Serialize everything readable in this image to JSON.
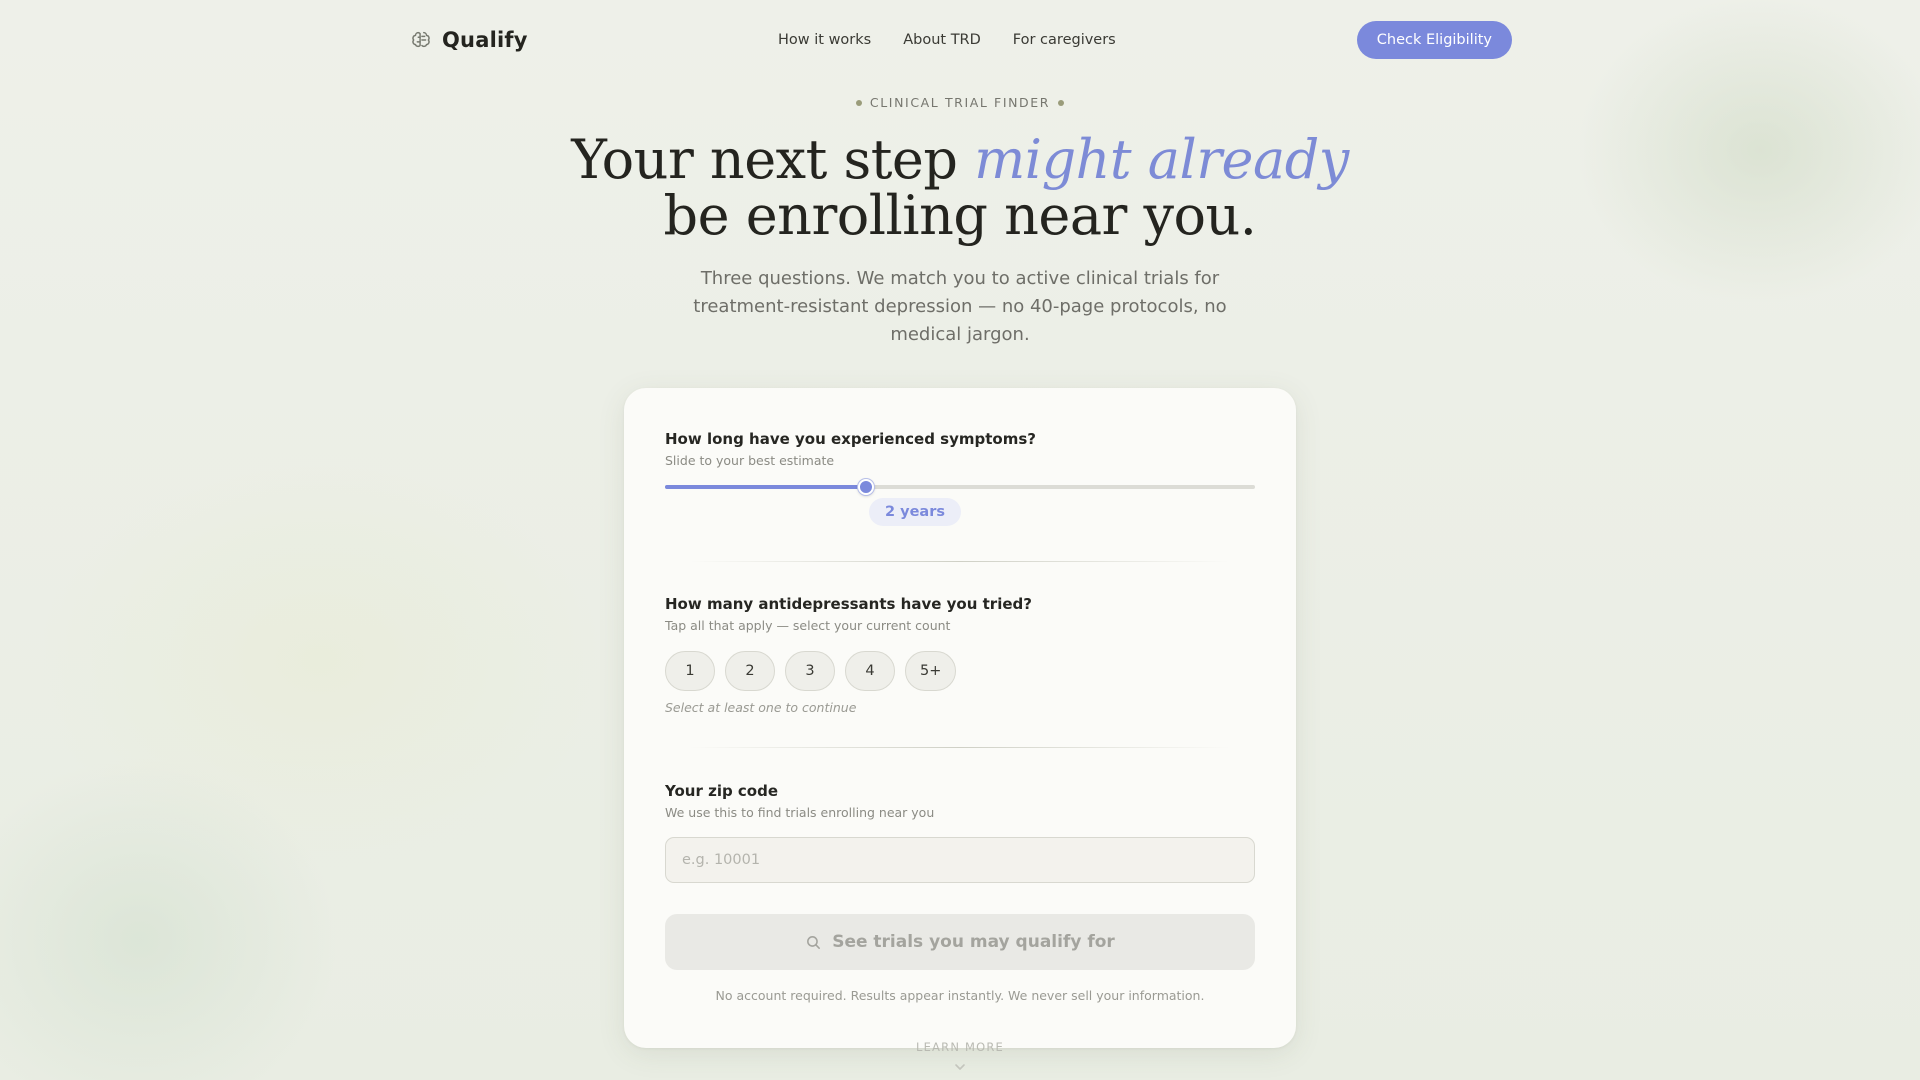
{
  "nav": {
    "brand": "Qualify",
    "brand_icon": "brain-icon",
    "links": [
      "How it works",
      "About TRD",
      "For caregivers"
    ],
    "cta": "Check Eligibility"
  },
  "hero": {
    "eyebrow": "CLINICAL TRIAL FINDER",
    "headline_part1": "Your next step ",
    "headline_emphasis": "might already",
    "headline_part2": "be enrolling near you.",
    "subtitle": "Three questions. We match you to active clinical trials for treatment-resistant depression — no 40-page protocols, no medical jargon."
  },
  "form": {
    "q1": {
      "title": "How long have you experienced symptoms?",
      "subtitle": "Slide to your best estimate",
      "value_label": "2 years",
      "slider_fraction": 0.34
    },
    "q2": {
      "title": "How many antidepressants have you tried?",
      "subtitle": "Tap all that apply — select your current count",
      "options": [
        "1",
        "2",
        "3",
        "4",
        "5+"
      ],
      "hint": "Select at least one to continue"
    },
    "q3": {
      "title": "Your zip code",
      "subtitle": "We use this to find trials enrolling near you",
      "placeholder": "e.g. 10001",
      "value": ""
    },
    "submit_label": "See trials you may qualify for",
    "submit_icon": "search-icon",
    "footnote": "No account required. Results appear instantly. We never sell your information."
  },
  "learn_more": "LEARN MORE",
  "learn_more_icon": "chevron-down-icon",
  "colors": {
    "accent": "#7b89dc",
    "background": "#ecefe6",
    "card": "#fbfbf8",
    "text": "#24241f"
  }
}
